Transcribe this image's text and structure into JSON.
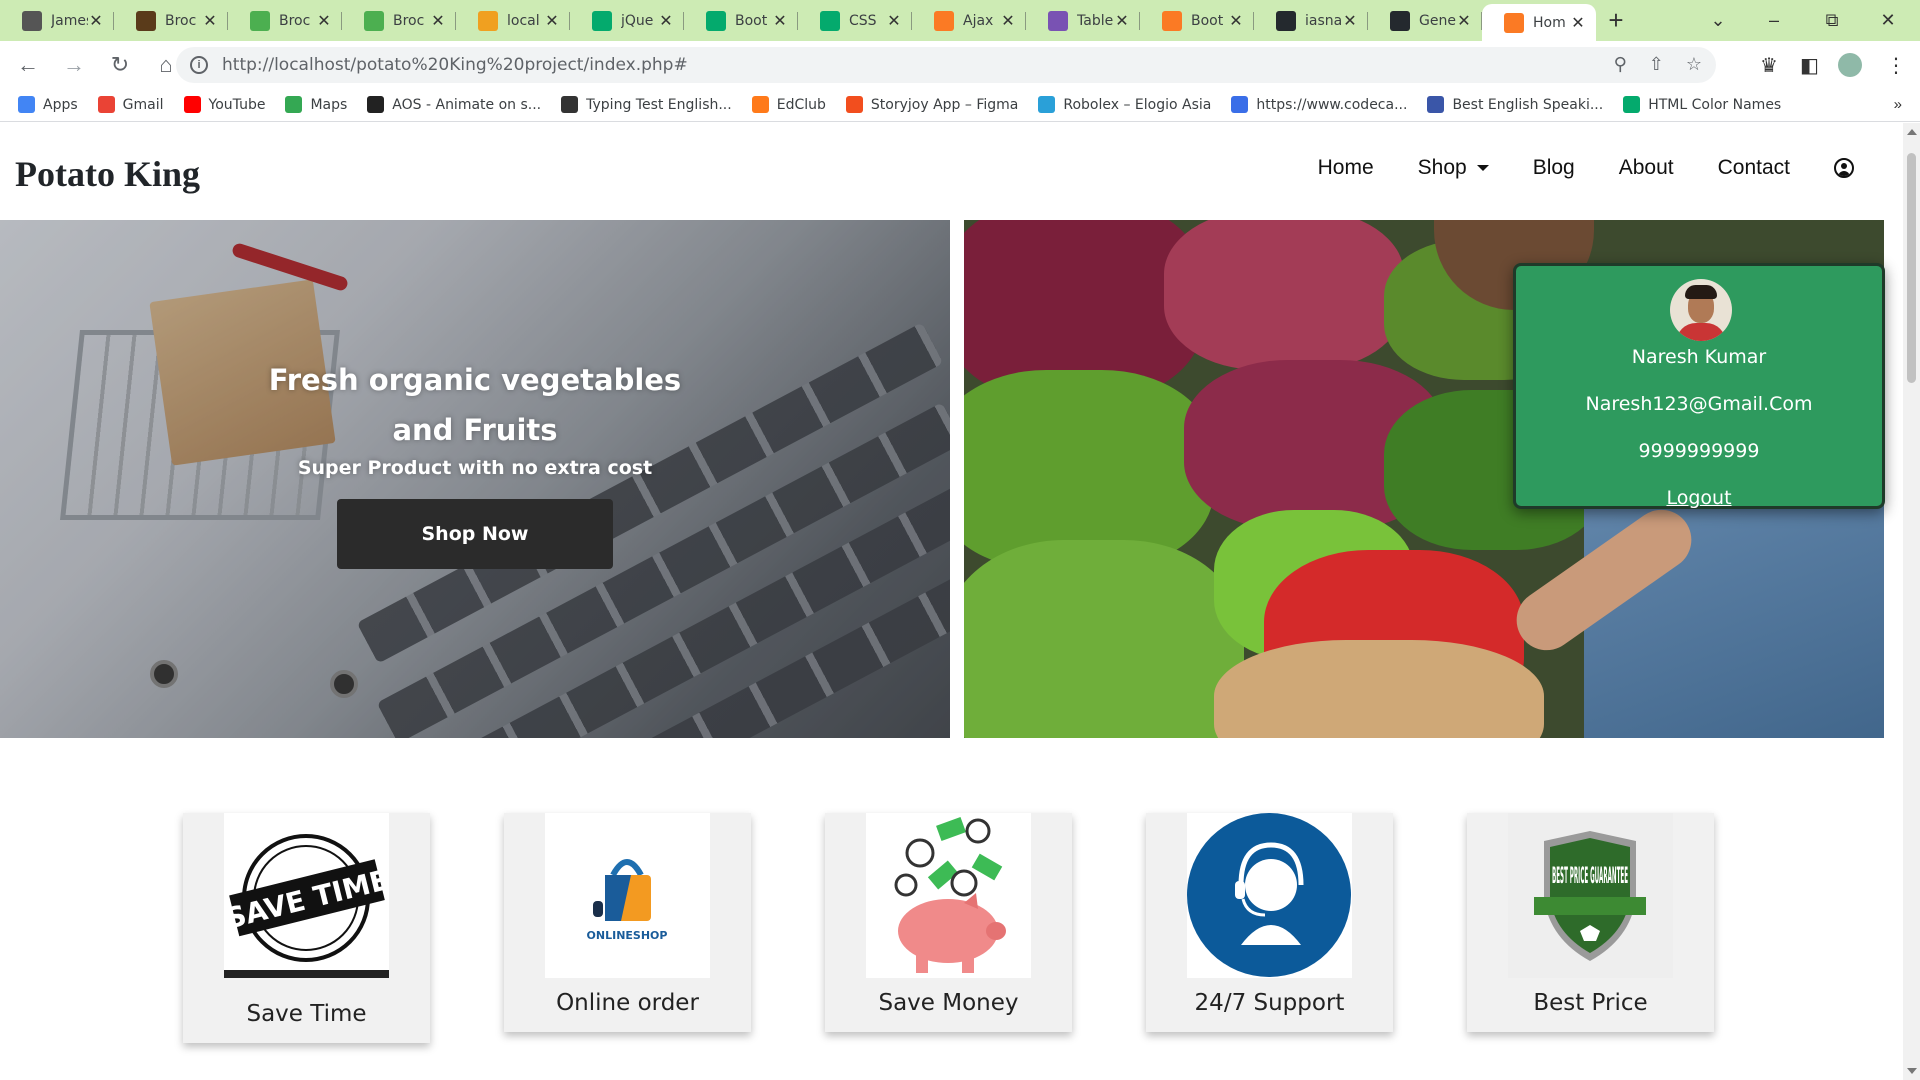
{
  "browser": {
    "tabs": [
      {
        "title": "James",
        "icon": "person-favicon",
        "color": "#555555"
      },
      {
        "title": "Broc",
        "icon": "book-favicon",
        "color": "#5a3b1a"
      },
      {
        "title": "Broc",
        "icon": "leaf-favicon",
        "color": "#4caf50"
      },
      {
        "title": "Broc",
        "icon": "leaf-favicon",
        "color": "#4caf50"
      },
      {
        "title": "local",
        "icon": "phpmyadmin-favicon",
        "color": "#f0a020"
      },
      {
        "title": "jQue",
        "icon": "w3schools-favicon",
        "color": "#04aa6d"
      },
      {
        "title": "Boot",
        "icon": "w3schools-favicon",
        "color": "#04aa6d"
      },
      {
        "title": "CSS",
        "icon": "w3schools-favicon",
        "color": "#04aa6d"
      },
      {
        "title": "Ajax",
        "icon": "xampp-favicon",
        "color": "#fb7a24"
      },
      {
        "title": "Table",
        "icon": "bootstrap-favicon",
        "color": "#7952b3"
      },
      {
        "title": "Boot",
        "icon": "xampp-favicon",
        "color": "#fb7a24"
      },
      {
        "title": "iasna",
        "icon": "github-favicon",
        "color": "#24292e"
      },
      {
        "title": "Gene",
        "icon": "github-favicon",
        "color": "#24292e"
      },
      {
        "title": "Hom",
        "icon": "xampp-favicon",
        "color": "#fb7a24",
        "active": true
      }
    ],
    "url": "http://localhost/potato%20King%20project/index.php#",
    "bookmarks": [
      {
        "label": "Apps",
        "icon": "apps-grid-icon",
        "color": "#4285f4"
      },
      {
        "label": "Gmail",
        "icon": "gmail-icon",
        "color": "#ea4335"
      },
      {
        "label": "YouTube",
        "icon": "youtube-icon",
        "color": "#ff0000"
      },
      {
        "label": "Maps",
        "icon": "maps-pin-icon",
        "color": "#34a853"
      },
      {
        "label": "AOS - Animate on s...",
        "icon": "aos-icon",
        "color": "#222222"
      },
      {
        "label": "Typing Test English...",
        "icon": "typing-icon",
        "color": "#333333"
      },
      {
        "label": "EdClub",
        "icon": "edclub-icon",
        "color": "#ff7a1a"
      },
      {
        "label": "Storyjoy App – Figma",
        "icon": "figma-icon",
        "color": "#f24e1e"
      },
      {
        "label": "Robolex – Elogio Asia",
        "icon": "robolex-icon",
        "color": "#2aa0d8"
      },
      {
        "label": "https://www.codeca...",
        "icon": "codecademy-icon",
        "color": "#3a6ee8"
      },
      {
        "label": "Best English Speaki...",
        "icon": "english-icon",
        "color": "#3a56a8"
      },
      {
        "label": "HTML Color Names",
        "icon": "w3schools-favicon",
        "color": "#04aa6d"
      }
    ]
  },
  "site": {
    "brand": "Potato King",
    "nav": {
      "home": "Home",
      "shop": "Shop",
      "blog": "Blog",
      "about": "About",
      "contact": "Contact"
    },
    "hero": {
      "title": "Fresh organic vegetables and Fruits",
      "subtitle": "Super Product with no extra cost",
      "button": "Shop Now"
    },
    "profile": {
      "name": "Naresh Kumar",
      "email": "Naresh123@Gmail.Com",
      "phone": "9999999999",
      "logout": "Logout",
      "bg_color": "#2e9a5e"
    },
    "features": [
      {
        "label": "Save Time",
        "icon": "save-time-stamp-icon",
        "stamp_text": "SAVE TIME"
      },
      {
        "label": "Online order",
        "icon": "online-shop-bag-icon",
        "stamp_text": "ONLINESHOP"
      },
      {
        "label": "Save Money",
        "icon": "piggy-bank-icon"
      },
      {
        "label": "24/7 Support",
        "icon": "headset-support-icon"
      },
      {
        "label": "Best Price",
        "icon": "best-price-badge-icon",
        "stamp_text": "BEST PRICE GUARANTEE"
      }
    ]
  },
  "colors": {
    "tabbar": "#cdebb4",
    "shop_button": "#2b2b2b"
  }
}
